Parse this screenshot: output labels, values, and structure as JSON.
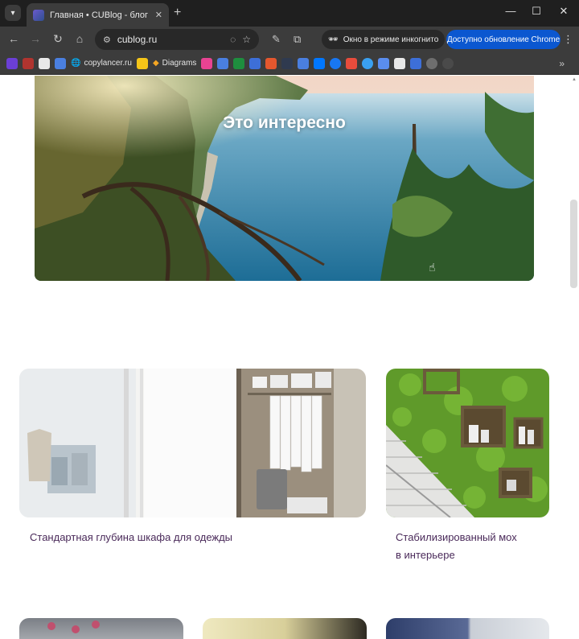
{
  "browser": {
    "tab_title": "Главная • CUBlog - блог о ди",
    "url": "cublog.ru",
    "incognito_label": "Окно в режиме инкогнито",
    "update_label": "Доступно обновление Chrome",
    "bookmarks": [
      {
        "text": "copylancer.ru"
      },
      {
        "text": "Diagrams"
      }
    ]
  },
  "hero": {
    "title": "Это интересно"
  },
  "cards": [
    {
      "title": "Стандартная глубина шкафа для одежды"
    },
    {
      "title_line1": "Стабилизированный мох",
      "title_line2": "в интерьере"
    }
  ],
  "colors": {
    "title_purple": "#4a2a5a",
    "update_blue": "#0b57d0"
  }
}
